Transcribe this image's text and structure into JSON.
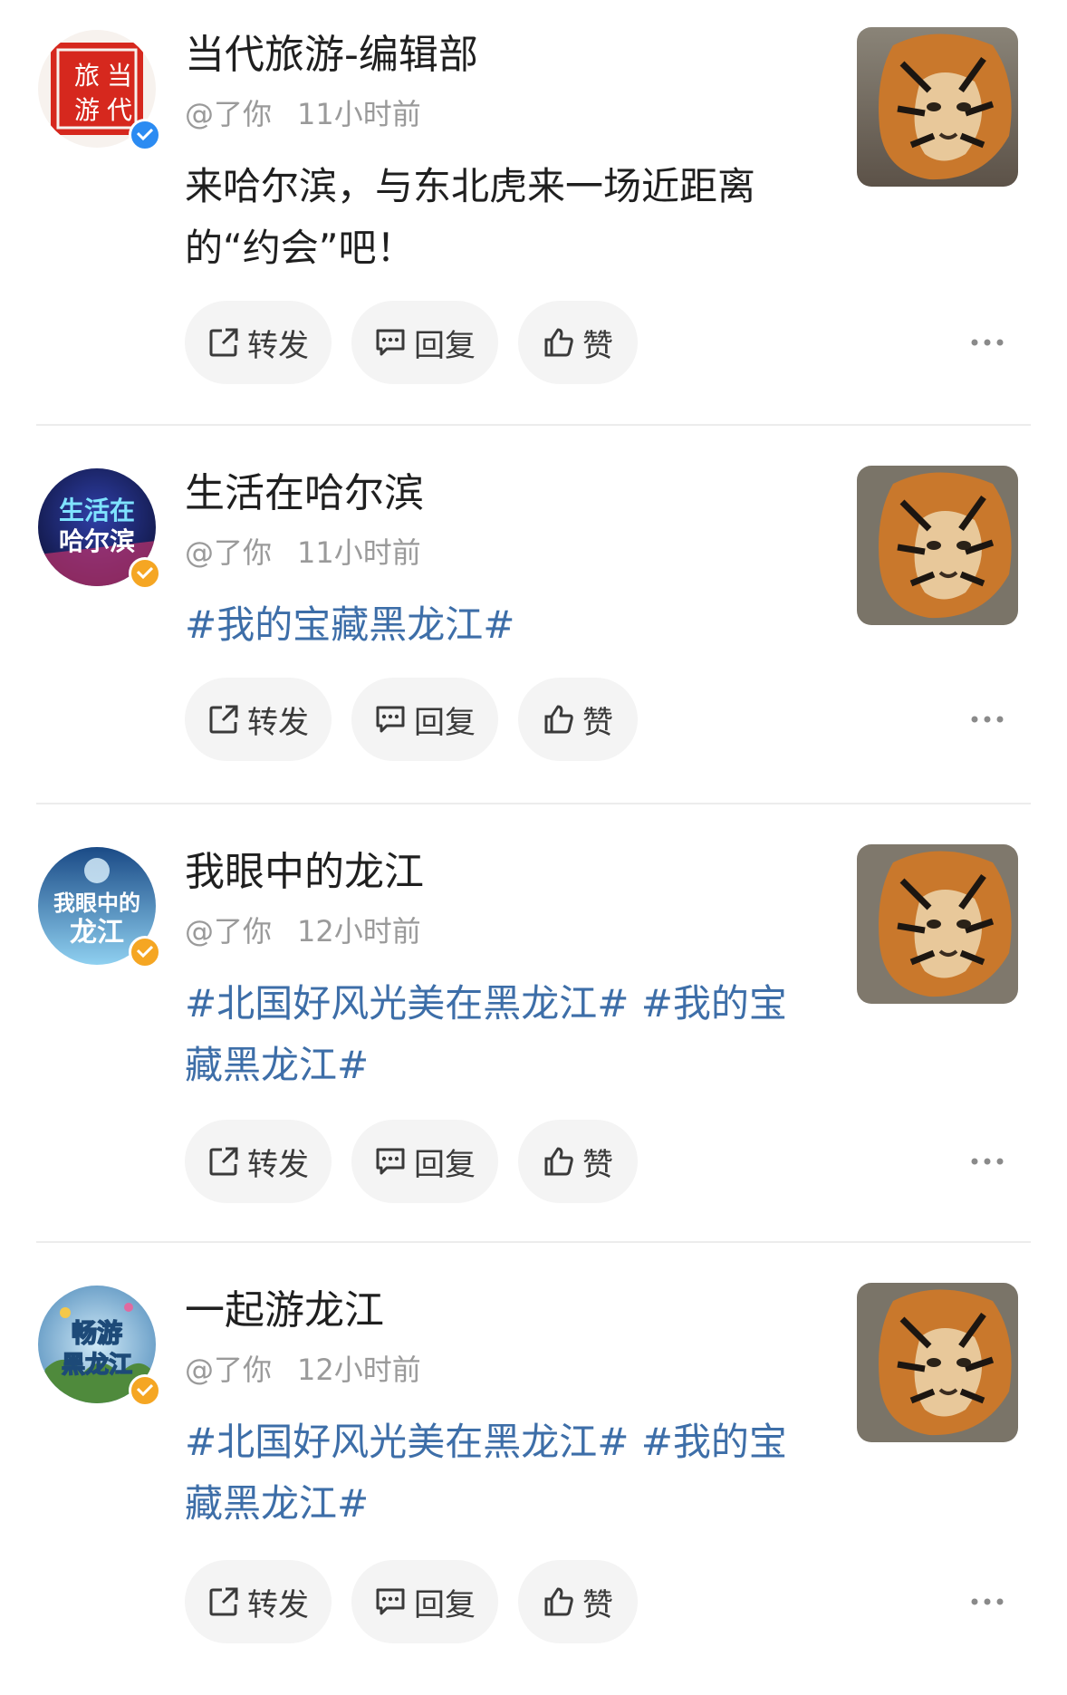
{
  "posts": [
    {
      "name": "当代旅游-编辑部",
      "mention": "@了你",
      "time": "11小时前",
      "content": "来哈尔滨，与东北虎来一场近距离的“约会”吧！",
      "content_is_topic": false,
      "avatar_text": [
        "旅",
        "当",
        "游",
        "代"
      ],
      "avatar_badge_color": "#2b8bf2"
    },
    {
      "name": "生活在哈尔滨",
      "mention": "@了你",
      "time": "11小时前",
      "content": "#我的宝藏黑龙江#",
      "content_is_topic": true,
      "avatar_text": [
        "生活在",
        "哈尔滨"
      ],
      "avatar_badge_color": "#f5a623"
    },
    {
      "name": "我眼中的龙江",
      "mention": "@了你",
      "time": "12小时前",
      "content": "#北国好风光美在黑龙江# #我的宝藏黑龙江#",
      "content_is_topic": true,
      "avatar_text": [
        "我眼中的",
        "龙江"
      ],
      "avatar_badge_color": "#f5a623"
    },
    {
      "name": "一起游龙江",
      "mention": "@了你",
      "time": "12小时前",
      "content": "#北国好风光美在黑龙江# #我的宝藏黑龙江#",
      "content_is_topic": true,
      "avatar_text": [
        "畅游",
        "黑龙江"
      ],
      "avatar_badge_color": "#f5a623"
    }
  ],
  "actions": {
    "repost": "转发",
    "reply": "回复",
    "like": "赞"
  },
  "colors": {
    "topic_link": "#3d6ea8",
    "pill_bg": "#f4f4f4",
    "meta_text": "#9a9a9a"
  },
  "icons": [
    "repost-icon",
    "comment-icon",
    "thumbs-up-icon",
    "more-icon",
    "verified-icon"
  ]
}
